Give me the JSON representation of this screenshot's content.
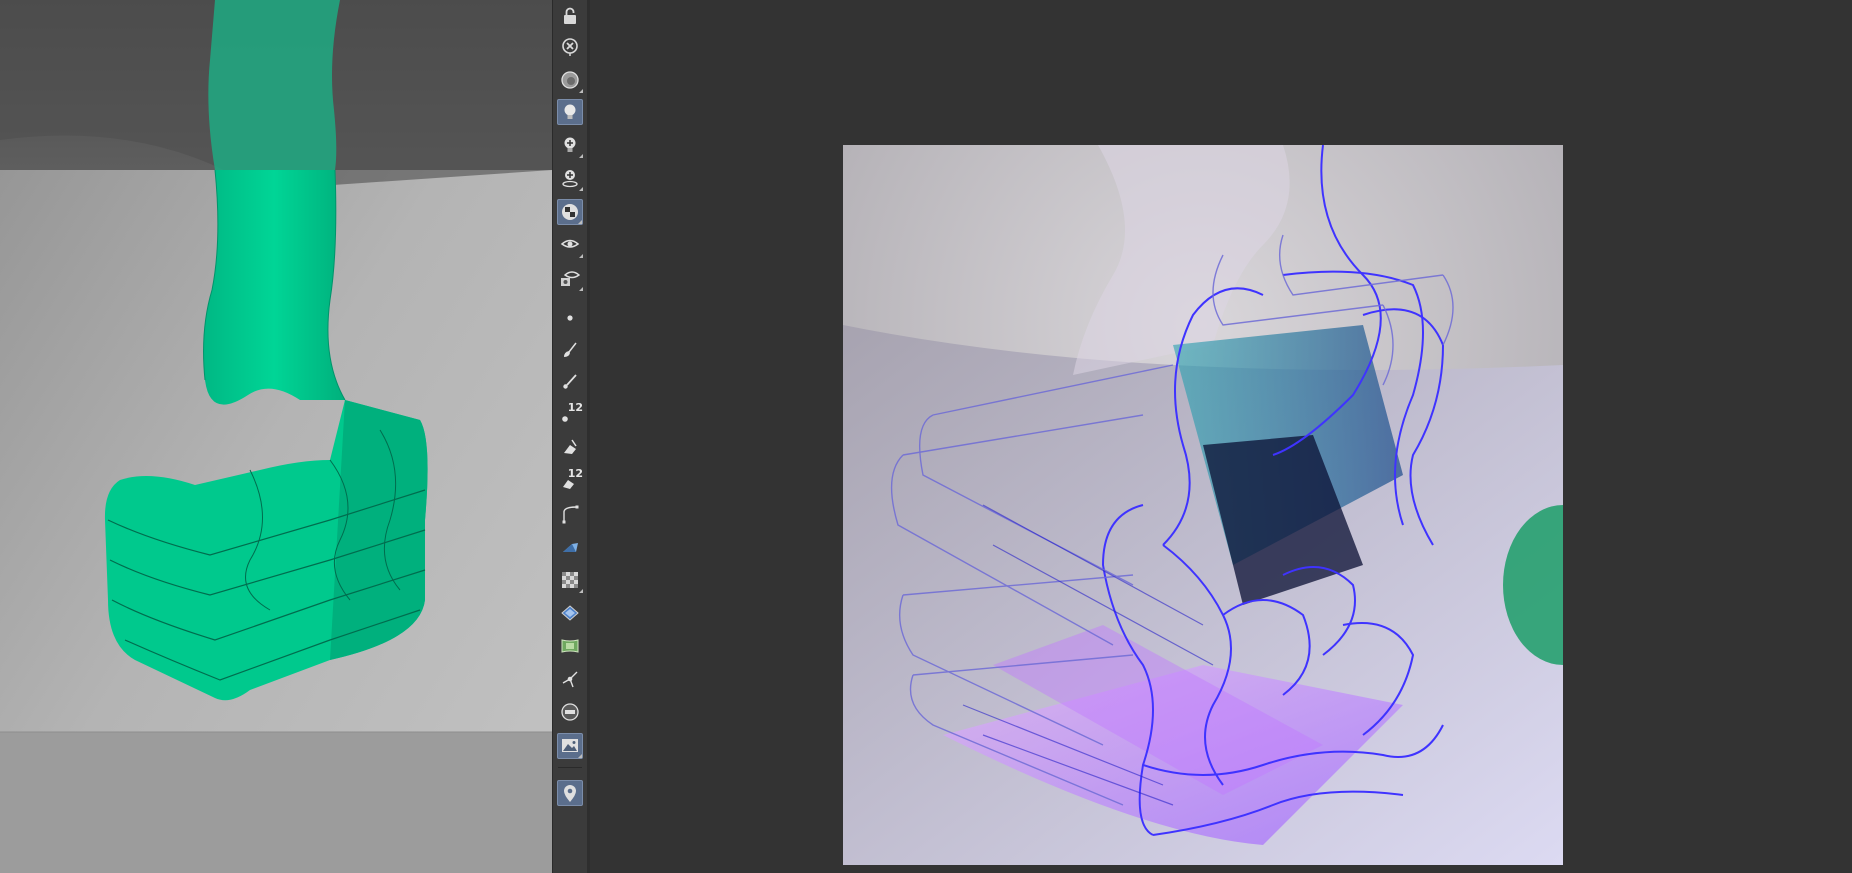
{
  "toolbar": {
    "badges": {
      "brush_size": "12",
      "erase_size": "12"
    },
    "tools": [
      "lock-icon",
      "close-circle-icon",
      "display-disk-icon",
      "light-bulb-icon",
      "add-light-icon",
      "place-light-icon",
      "camera-checker-icon",
      "view-eye-icon",
      "render-eye-icon",
      "point-icon",
      "brush-icon",
      "pen-icon",
      "brush-size-icon",
      "erase-icon",
      "erase-size-icon",
      "curve-icon",
      "shape-icon",
      "checker-icon",
      "diamond-icon",
      "map-icon",
      "transform-icon",
      "panel-icon",
      "image-view-icon",
      "pin-icon"
    ]
  },
  "colors": {
    "app_background": "#333333",
    "toolbar_background": "#3b3b3b",
    "active_tool": "#5b6e8c",
    "ribbon_green": "#00c98d",
    "render_blue": "#3a2bff",
    "render_violet": "#c36bff"
  }
}
